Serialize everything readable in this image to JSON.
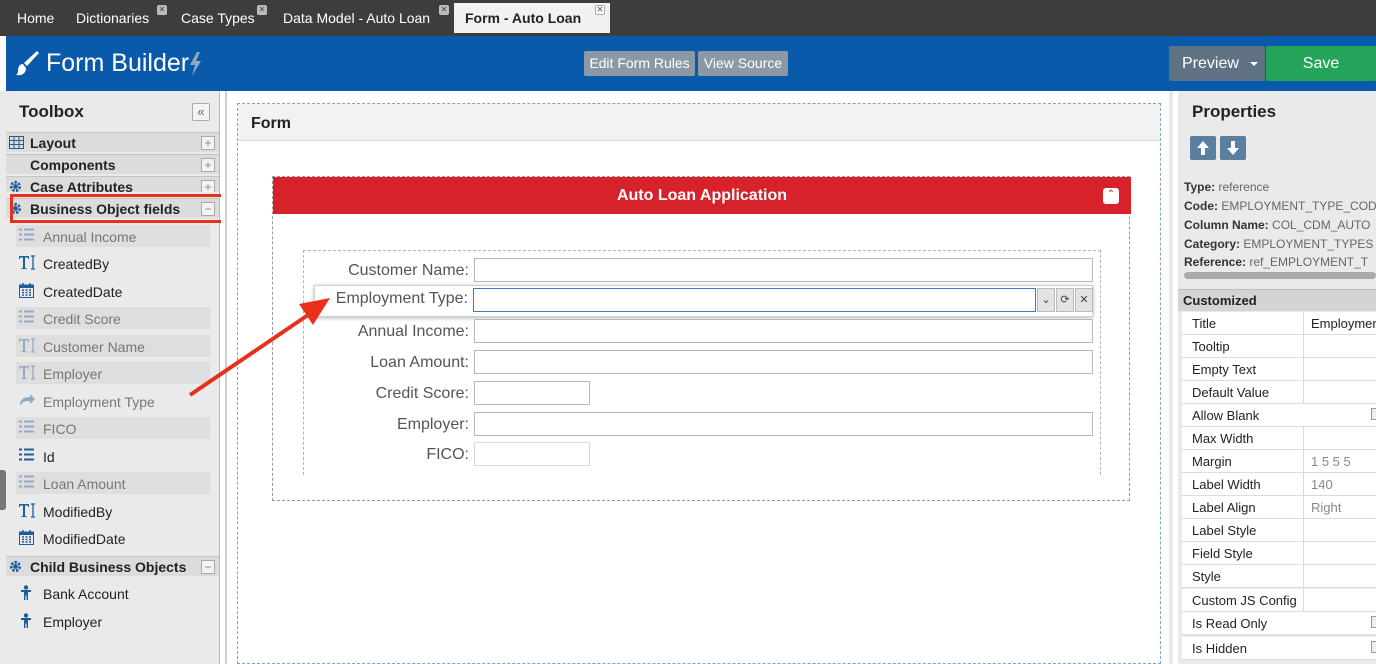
{
  "tabs": [
    {
      "label": "Home",
      "closable": false,
      "active": false
    },
    {
      "label": "Dictionaries",
      "closable": true,
      "active": false
    },
    {
      "label": "Case Types",
      "closable": true,
      "active": false
    },
    {
      "label": "Data Model - Auto Loan",
      "closable": true,
      "active": false
    },
    {
      "label": "Form - Auto Loan",
      "closable": true,
      "active": true
    }
  ],
  "header": {
    "title": "Form Builder",
    "edit_rules": "Edit Form Rules",
    "view_source": "View Source",
    "preview": "Preview",
    "save": "Save",
    "colors": {
      "bar": "#0a5aab",
      "save": "#24a35a",
      "preview": "#607384"
    }
  },
  "toolbox": {
    "title": "Toolbox",
    "sections": {
      "layout": "Layout",
      "components": "Components",
      "case_attributes": "Case Attributes",
      "business_object_fields": "Business Object fields",
      "child_business_objects": "Child Business Objects"
    },
    "fields": [
      {
        "label": "Annual Income",
        "icon": "list-icon",
        "disabled": true
      },
      {
        "label": "CreatedBy",
        "icon": "text-field-icon",
        "disabled": false
      },
      {
        "label": "CreatedDate",
        "icon": "calendar-icon",
        "disabled": false
      },
      {
        "label": "Credit Score",
        "icon": "list-icon",
        "disabled": true
      },
      {
        "label": "Customer Name",
        "icon": "text-field-icon",
        "disabled": true
      },
      {
        "label": "Employer",
        "icon": "text-field-icon",
        "disabled": true
      },
      {
        "label": "Employment Type",
        "icon": "reference-arrow-icon",
        "disabled": true
      },
      {
        "label": "FICO",
        "icon": "list-icon",
        "disabled": true
      },
      {
        "label": "Id",
        "icon": "list-icon",
        "disabled": false
      },
      {
        "label": "Loan Amount",
        "icon": "list-icon",
        "disabled": true
      },
      {
        "label": "ModifiedBy",
        "icon": "text-field-icon",
        "disabled": false
      },
      {
        "label": "ModifiedDate",
        "icon": "calendar-icon",
        "disabled": false
      }
    ],
    "children": [
      {
        "label": "Bank Account",
        "icon": "person-icon"
      },
      {
        "label": "Employer",
        "icon": "person-icon"
      }
    ]
  },
  "form": {
    "title": "Form",
    "fieldset_title": "Auto Loan Application",
    "fieldset_color": "#d7222b",
    "fields": {
      "customer_name": "Customer Name:",
      "employment_type": "Employment Type:",
      "annual_income": "Annual Income:",
      "loan_amount": "Loan Amount:",
      "credit_score": "Credit Score:",
      "employer": "Employer:",
      "fico": "FICO:"
    }
  },
  "annotation": {
    "highlight_color": "#e8301d"
  },
  "properties": {
    "title": "Properties",
    "info": {
      "type_label": "Type:",
      "type_value": "reference",
      "code_label": "Code:",
      "code_value": "EMPLOYMENT_TYPE_COD",
      "column_label": "Column Name:",
      "column_value": "COL_CDM_AUTO",
      "category_label": "Category:",
      "category_value": "EMPLOYMENT_TYPES",
      "reference_label": "Reference:",
      "reference_value": "ref_EMPLOYMENT_T"
    },
    "customized": "Customized",
    "rows": [
      {
        "name": "Title",
        "value": "Employmen"
      },
      {
        "name": "Tooltip",
        "value": ""
      },
      {
        "name": "Empty Text",
        "value": ""
      },
      {
        "name": "Default Value",
        "value": ""
      },
      {
        "name": "Allow Blank",
        "value": ""
      },
      {
        "name": "Max Width",
        "value": ""
      },
      {
        "name": "Margin",
        "value": "1 5 5 5"
      },
      {
        "name": "Label Width",
        "value": "140"
      },
      {
        "name": "Label Align",
        "value": "Right"
      },
      {
        "name": "Label Style",
        "value": ""
      },
      {
        "name": "Field Style",
        "value": ""
      },
      {
        "name": "Style",
        "value": ""
      },
      {
        "name": "Custom JS Config",
        "value": ""
      },
      {
        "name": "Is Read Only",
        "value": ""
      },
      {
        "name": "Is Hidden",
        "value": ""
      }
    ]
  }
}
